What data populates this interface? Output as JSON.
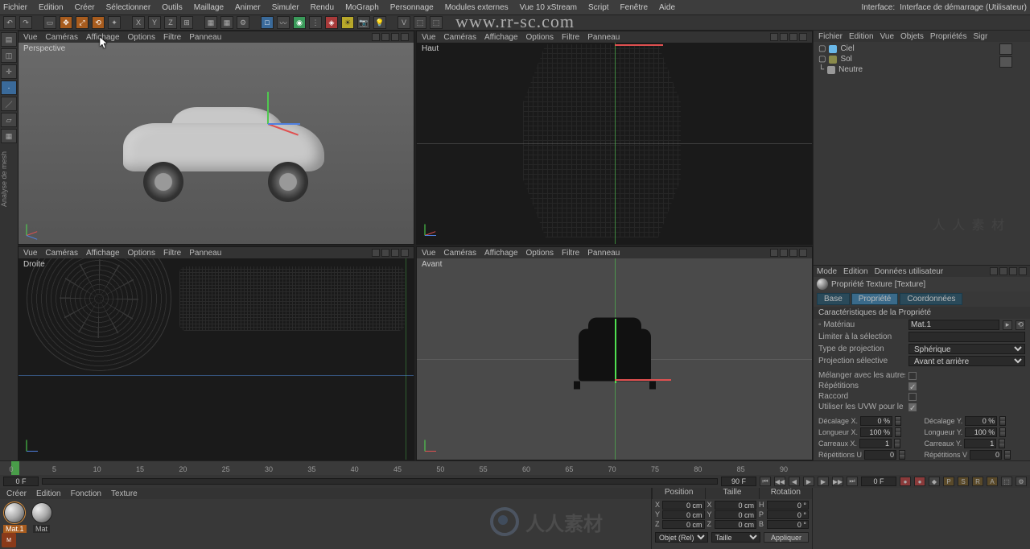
{
  "menubar": [
    "Fichier",
    "Edition",
    "Créer",
    "Sélectionner",
    "Outils",
    "Maillage",
    "Animer",
    "Simuler",
    "Rendu",
    "MoGraph",
    "Personnage",
    "Modules externes",
    "Vue 10 xStream",
    "Script",
    "Fenêtre",
    "Aide"
  ],
  "menubar_right_label": "Interface:",
  "menubar_right_value": "Interface de démarrage (Utilisateur)",
  "overlay_url": "www.rr-sc.com",
  "viewport_menu": [
    "Vue",
    "Caméras",
    "Affichage",
    "Options",
    "Filtre",
    "Panneau"
  ],
  "vp_labels": {
    "pers": "Perspective",
    "top": "Haut",
    "right": "Droite",
    "front": "Avant"
  },
  "objects_menu": [
    "Fichier",
    "Edition",
    "Vue",
    "Objets",
    "Propriétés",
    "Sigr"
  ],
  "objects": [
    {
      "name": "Ciel",
      "icon": "sky"
    },
    {
      "name": "Sol",
      "icon": "floor"
    },
    {
      "name": "Neutre",
      "icon": "null",
      "prefix": "└"
    }
  ],
  "watermark_tr": "人 人 素 材",
  "attr_menu": [
    "Mode",
    "Edition",
    "Données utilisateur"
  ],
  "attr_title": "Propriété Texture [Texture]",
  "attr_tabs": [
    "Base",
    "Propriété",
    "Coordonnées"
  ],
  "attr_section": "Caractéristiques de la Propriété",
  "attr": {
    "material_label": "Matériau",
    "material_value": "Mat.1",
    "limit_label": "Limiter à la sélection",
    "limit_value": "",
    "proj_label": "Type de projection",
    "proj_value": "Sphérique",
    "projsel_label": "Projection sélective",
    "projsel_value": "Avant et arrière",
    "mix_label": "Mélanger avec les autres textures",
    "rep_label": "Répétitions",
    "rac_label": "Raccord",
    "uvw_label": "Utiliser les UVW pour le relief"
  },
  "attr_nums": [
    {
      "l1": "Décalage X.",
      "v1": "0 %",
      "l2": "Décalage Y.",
      "v2": "0 %"
    },
    {
      "l1": "Longueur X.",
      "v1": "100 %",
      "l2": "Longueur Y.",
      "v2": "100 %"
    },
    {
      "l1": "Carreaux X.",
      "v1": "1",
      "l2": "Carreaux Y.",
      "v2": "1"
    },
    {
      "l1": "Répétitions U",
      "v1": "0",
      "l2": "Répétitions V",
      "v2": "0"
    }
  ],
  "timeline": {
    "start": "0 F",
    "end": "90 F",
    "cur": "0 F",
    "marks": [
      0,
      5,
      10,
      15,
      20,
      25,
      30,
      35,
      40,
      45,
      50,
      55,
      60,
      65,
      70,
      75,
      80,
      85,
      90
    ]
  },
  "mat_menu": [
    "Créer",
    "Edition",
    "Fonction",
    "Texture"
  ],
  "materials": [
    {
      "name": "Mat.1",
      "selected": true
    },
    {
      "name": "Mat",
      "selected": false
    }
  ],
  "mat_watermark": "人人素材",
  "coord": {
    "headers": [
      "Position",
      "Taille",
      "Rotation"
    ],
    "rows": [
      {
        "a": "X",
        "p": "0 cm",
        "s": "X",
        "sv": "0 cm",
        "r": "H",
        "rv": "0 °"
      },
      {
        "a": "Y",
        "p": "0 cm",
        "s": "Y",
        "sv": "0 cm",
        "r": "P",
        "rv": "0 °"
      },
      {
        "a": "Z",
        "p": "0 cm",
        "s": "Z",
        "sv": "0 cm",
        "r": "B",
        "rv": "0 °"
      }
    ],
    "mode1": "Objet (Rel)",
    "mode2": "Taille",
    "apply": "Appliquer"
  }
}
